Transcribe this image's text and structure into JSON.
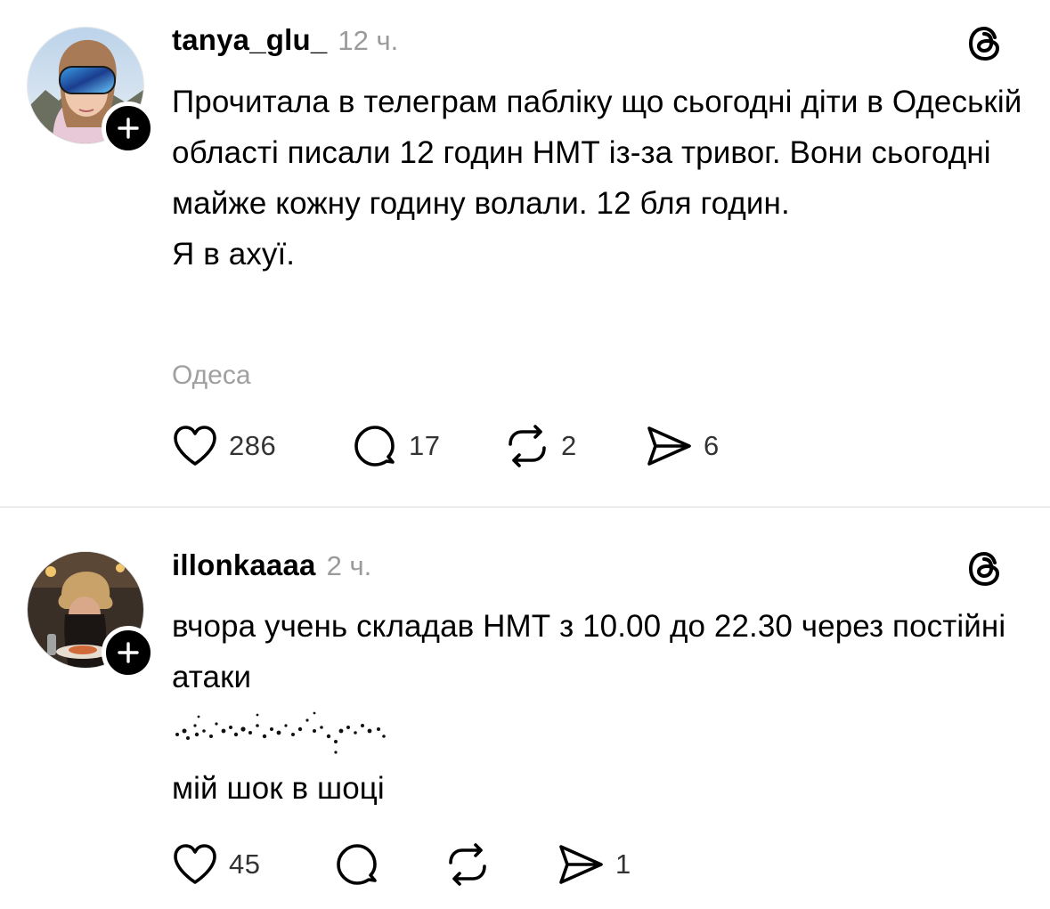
{
  "posts": [
    {
      "username": "tanya_glu_",
      "time": "12 ч.",
      "paragraphs": [
        "Прочитала в телеграм пабліку що сьогодні діти в Одеській області писали 12 годин НМТ із-за тривог. Вони сьогодні майже кожну годину волали. 12 бля годин.",
        "Я в ахуї."
      ],
      "location": "Одеса",
      "likes": "286",
      "replies": "17",
      "reposts": "2",
      "shares": "6"
    },
    {
      "username": "illonkaaaa",
      "time": "2 ч.",
      "paragraphs": [
        "вчора учень складав НМТ з 10.00 до 22.30 через постійні атаки",
        "мій шок в шоці"
      ],
      "likes": "45",
      "shares": "1"
    }
  ],
  "icons": {
    "avatar_badge": "plus-icon",
    "brand": "threads-icon",
    "like": "heart-icon",
    "reply": "comment-icon",
    "repost": "repost-icon",
    "share": "send-icon"
  },
  "colors": {
    "text": "#000000",
    "muted": "#9a9a9a",
    "count": "#333333",
    "divider": "#d9d9d9"
  }
}
